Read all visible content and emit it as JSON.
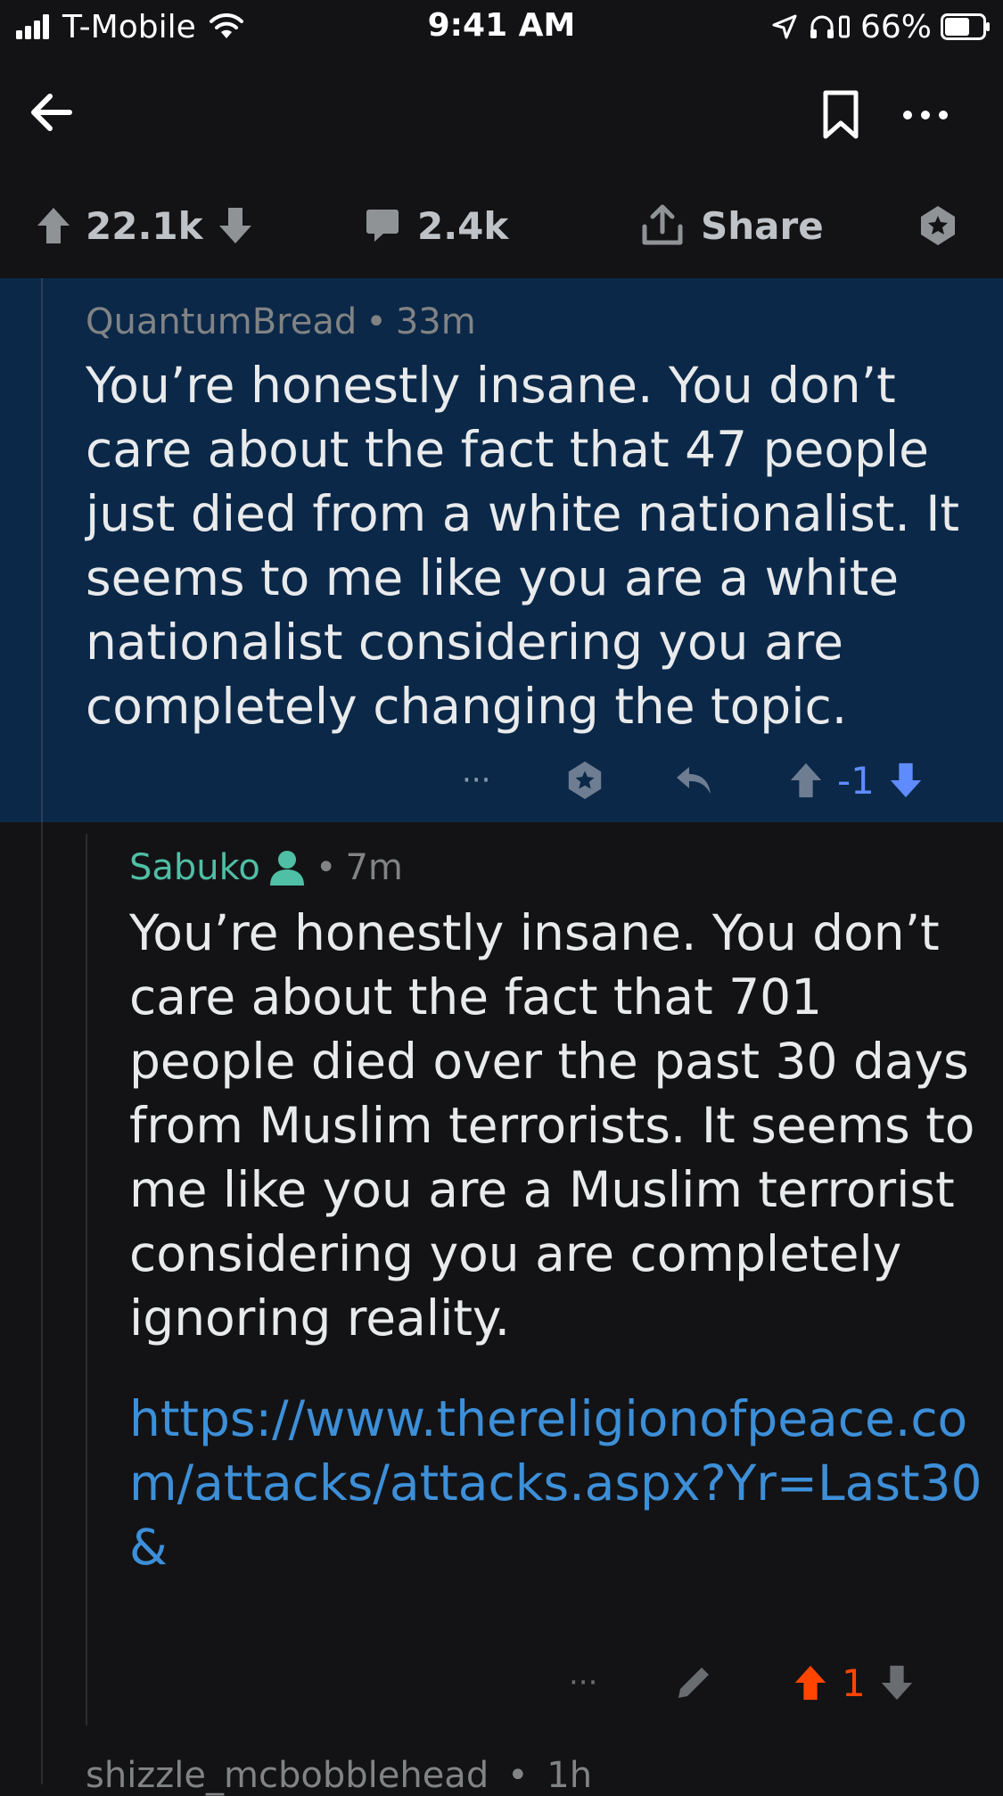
{
  "status_bar": {
    "carrier": "T-Mobile",
    "time": "9:41 AM",
    "battery": "66%",
    "battery_level": 0.66
  },
  "post_actions": {
    "score": "22.1k",
    "comment_count": "2.4k",
    "share_label": "Share"
  },
  "parent_comment": {
    "author": "QuantumBread",
    "separator": "•",
    "age": "33m",
    "body": "You’re honestly insane. You don’t care about the fact that 47 people just died from a white nationalist. It seems to me like you are a white nationalist considering you are completely changing the topic.",
    "more": "···",
    "score": "-1",
    "vote_state": "downvoted",
    "highlight_color": "#0b2848"
  },
  "reply_comment": {
    "author": "Sabuko",
    "separator": "•",
    "age": "7m",
    "body": "You’re honestly insane. You don’t care about the fact that 701 people died over the past 30 days from Muslim terrorists. It seems to me like you are a Muslim terrorist considering you are completely ignoring reality.",
    "link": "https://www.thereligionofpeace.com/attacks/attacks.aspx?Yr=Last30&",
    "more": "···",
    "score": "1",
    "vote_state": "upvoted",
    "upvote_color": "#ff4500"
  },
  "next_comment": {
    "author": "shizzle_mcbobblehead",
    "separator": "•",
    "age": "1h"
  },
  "colors": {
    "background": "#131315",
    "downvote_blue": "#5e8cff",
    "author_green": "#4fbfa5",
    "link_blue": "#3d8fd8"
  }
}
